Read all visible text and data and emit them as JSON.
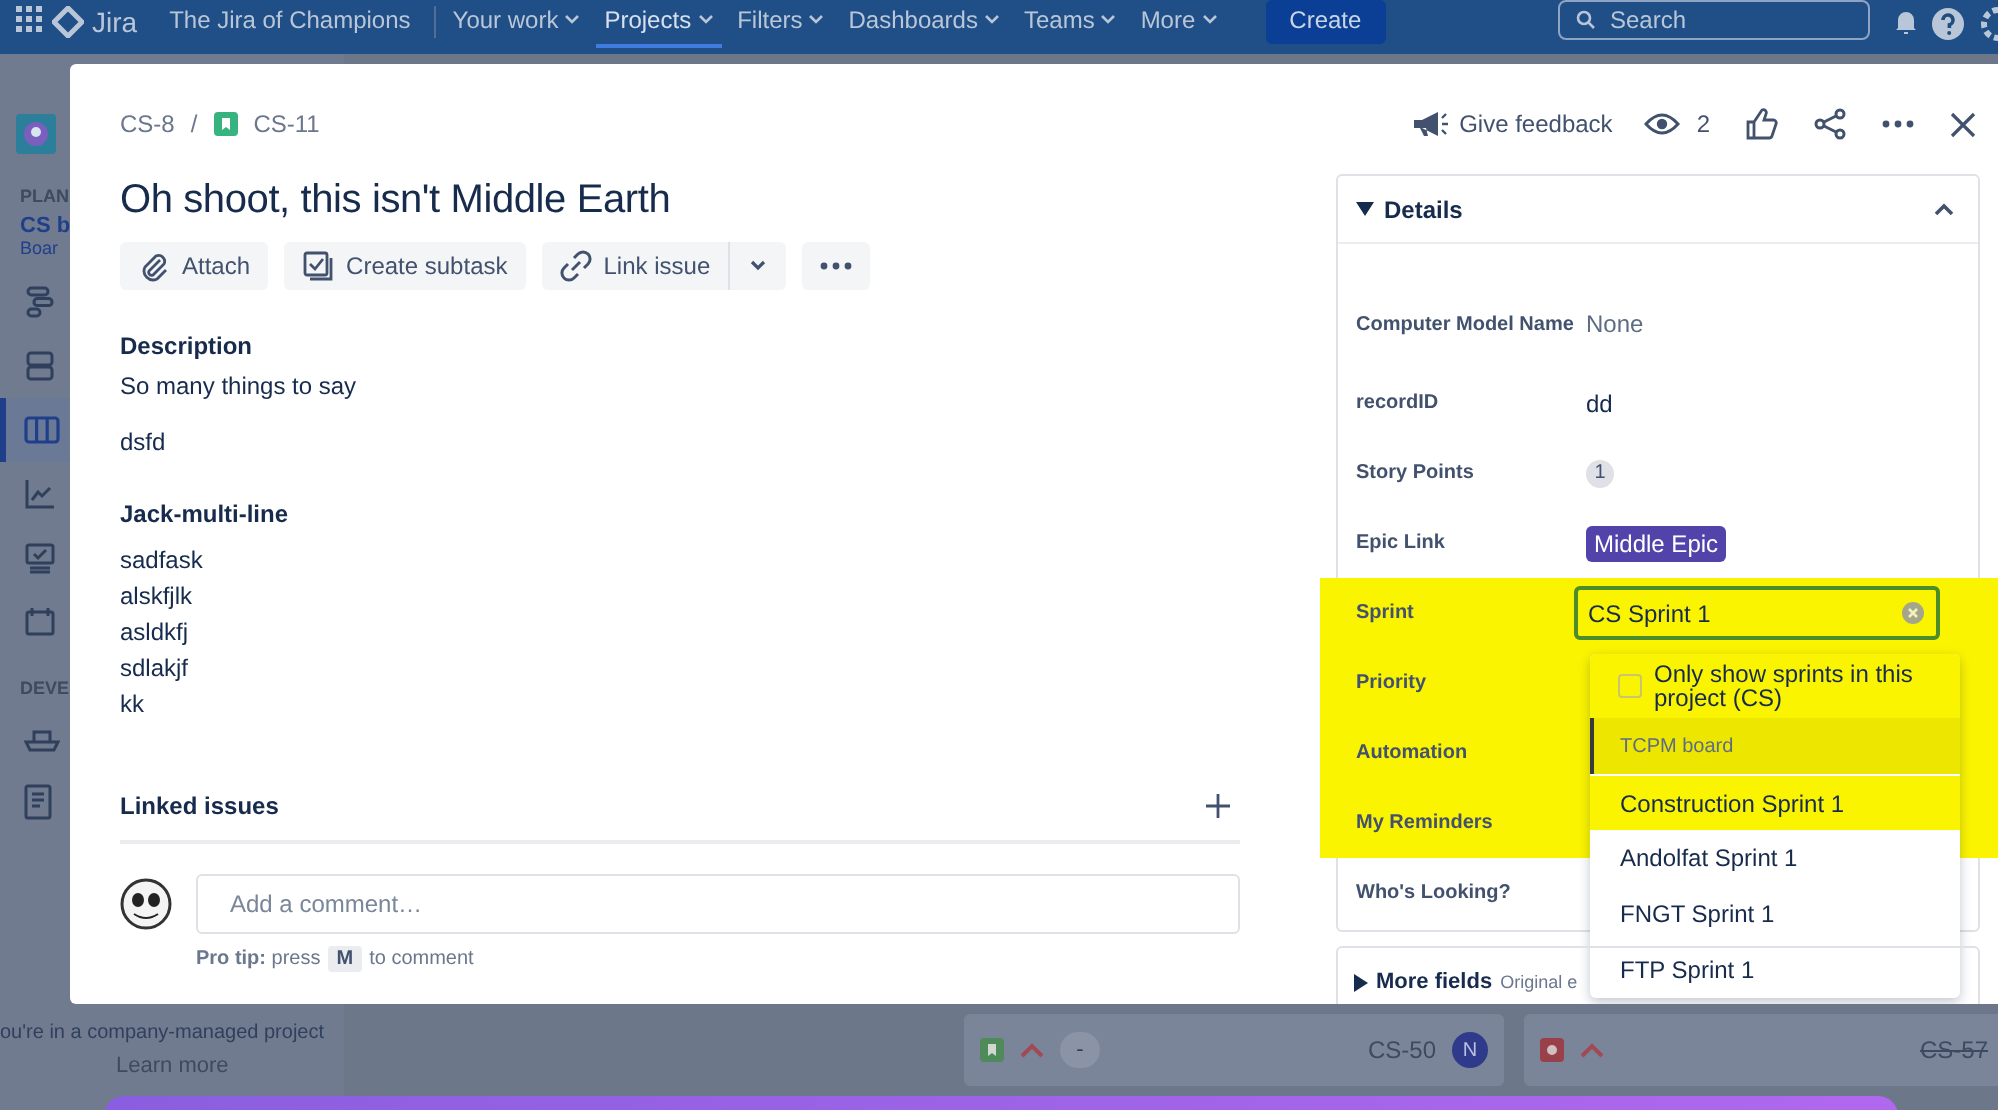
{
  "nav": {
    "app_name": "Jira",
    "site": "The Jira of Champions",
    "items": [
      {
        "label": "Your work",
        "selected": false
      },
      {
        "label": "Projects",
        "selected": true
      },
      {
        "label": "Filters",
        "selected": false
      },
      {
        "label": "Dashboards",
        "selected": false
      },
      {
        "label": "Teams",
        "selected": false
      },
      {
        "label": "More",
        "selected": false
      }
    ],
    "create": "Create",
    "search": {
      "placeholder": "Search"
    }
  },
  "sidebar": {
    "section_1": "PLAN",
    "project": "CS b",
    "board": "Boar",
    "section_2": "DEVE",
    "items": [
      {
        "selected": false
      },
      {
        "selected": false
      },
      {
        "selected": true
      },
      {
        "selected": false
      },
      {
        "selected": false
      },
      {
        "selected": false
      },
      {
        "selected": false
      },
      {
        "selected": false
      }
    ],
    "notice": "ou're in a company-managed project",
    "learn_more": "Learn more"
  },
  "board_cards": [
    {
      "kind": "story",
      "badge": "-",
      "key": "CS-50",
      "assignee": "N",
      "done": false
    },
    {
      "kind": "bug",
      "key": "CS-57",
      "done": true
    }
  ],
  "issue": {
    "parent": "CS-8",
    "separator": "/",
    "key": "CS-11",
    "title": "Oh shoot, this isn't Middle Earth",
    "actions": [
      "Attach",
      "Create subtask",
      "Link issue"
    ],
    "description_heading": "Description",
    "description": [
      "So many things to say",
      "dsfd"
    ],
    "custom_field": {
      "label": "Jack-multi-line",
      "lines": [
        "sadfask",
        "alskfjlk",
        "asldkfj",
        "sdlakjf",
        "kk"
      ]
    },
    "linked_issues": "Linked issues",
    "comment": {
      "placeholder": "Add a comment…",
      "tip": "**Pro tip:** press",
      "key": "M",
      "tip_end": "to comment"
    }
  },
  "header": {
    "feedback": "Give feedback",
    "watchers": "2"
  },
  "details": {
    "title": "Details",
    "expanded": true,
    "fields": [
      {
        "label": "Computer Model Name",
        "kind": "muted",
        "value": "None",
        "highlighted": false
      },
      {
        "label": "recordID",
        "kind": "text",
        "value": "dd",
        "highlighted": false
      },
      {
        "label": "Story Points",
        "kind": "count",
        "value": "1",
        "highlighted": false
      },
      {
        "label": "Epic Link",
        "kind": "epic",
        "value": "Middle Epic",
        "color": "#5243aa",
        "highlighted": false
      },
      {
        "label": "Sprint",
        "kind": "input",
        "value": "CS Sprint 1",
        "highlighted": true
      },
      {
        "label": "Priority",
        "kind": "none",
        "highlighted": true
      },
      {
        "label": "Automation",
        "kind": "none",
        "highlighted": true
      },
      {
        "label": "My Reminders",
        "kind": "none",
        "highlighted": true
      },
      {
        "label": "Who's Looking?",
        "kind": "none",
        "highlighted": false
      }
    ]
  },
  "dropdown": {
    "checkbox": {
      "label": "Only show sprints in this project (CS)",
      "checked": false
    },
    "group": "TCPM board",
    "options": [
      {
        "label": "Construction Sprint 1",
        "selected": false
      },
      {
        "label": "Andolfat Sprint 1",
        "selected": false
      },
      {
        "label": "FNGT Sprint 1",
        "selected": false
      },
      {
        "label": "FTP Sprint 1",
        "selected": false
      }
    ]
  },
  "more_fields": {
    "label": "More fields",
    "hint": "Original e"
  }
}
